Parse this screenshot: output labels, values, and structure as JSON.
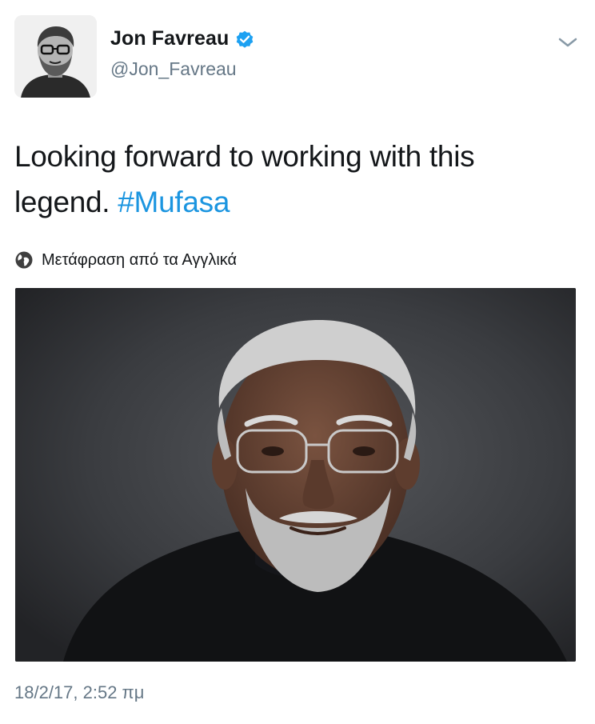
{
  "user": {
    "display_name": "Jon Favreau",
    "handle": "@Jon_Favreau",
    "verified": true
  },
  "tweet": {
    "text_before_hashtag": "Looking forward to working with this legend. ",
    "hashtag": "#Mufasa",
    "translate_label": "Μετάφραση από τα Αγγλικά",
    "timestamp": "18/2/17, 2:52 πμ"
  },
  "icons": {
    "verified": "verified-badge-icon",
    "menu": "chevron-down-icon",
    "translate": "globe-icon"
  },
  "colors": {
    "text": "#14171a",
    "secondary": "#657786",
    "link": "#1b95e0",
    "verified": "#1da1f2"
  }
}
